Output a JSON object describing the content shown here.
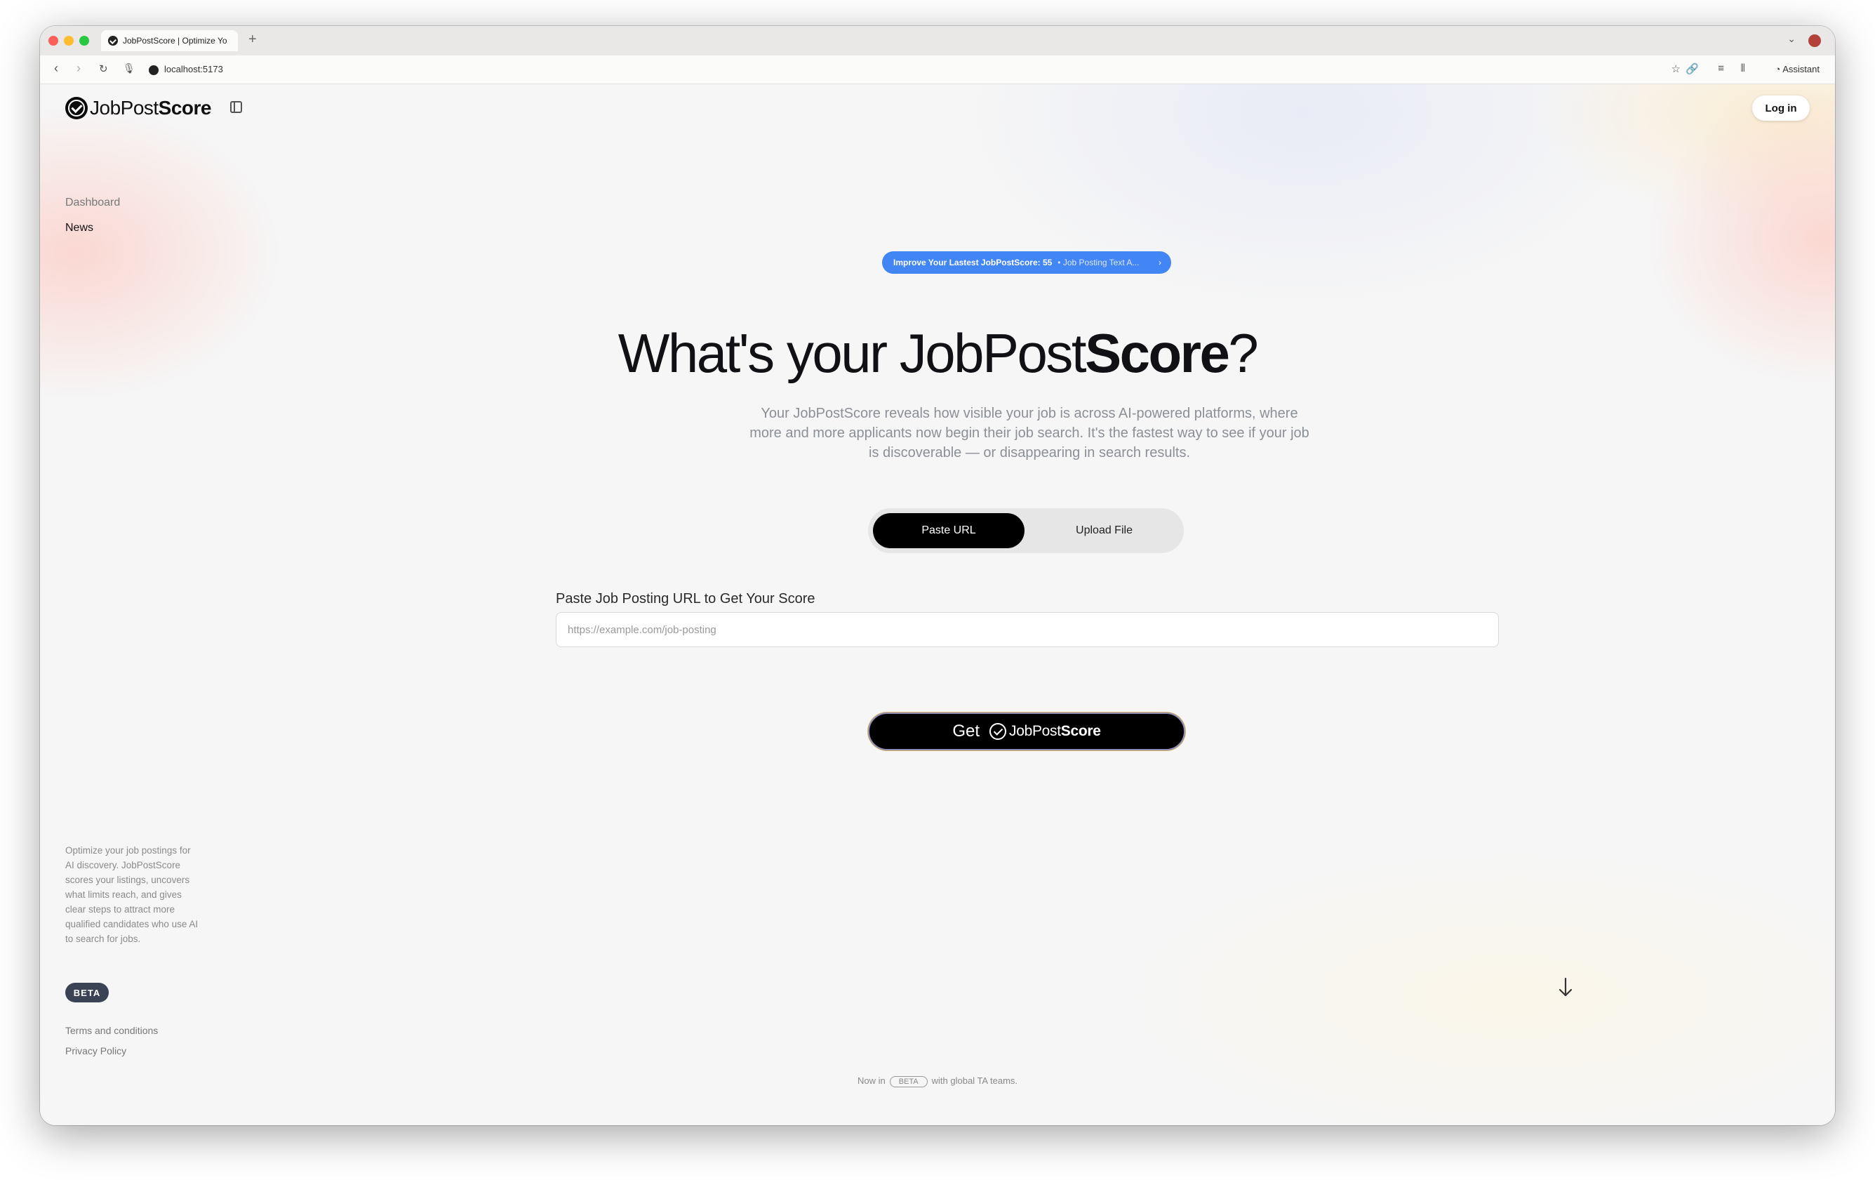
{
  "browser": {
    "tab_title": "JobPostScore | Optimize Yo",
    "new_tab": "+",
    "url": "localhost:5173",
    "assistant_label": "Assistant",
    "traffic_light_colors": [
      "#fe5f57",
      "#febc2e",
      "#28c840"
    ]
  },
  "header": {
    "logo_regular": "JobPost",
    "logo_bold": "Score",
    "login_label": "Log in"
  },
  "sidebar": {
    "items": [
      {
        "label": "Dashboard"
      },
      {
        "label": "News"
      }
    ],
    "description": "Optimize your job postings for AI discovery. JobPostScore scores your listings, uncovers what limits reach, and gives clear steps to attract more qualified candidates who use AI to search for jobs.",
    "badge": "BETA",
    "terms": "Terms and conditions",
    "privacy": "Privacy Policy"
  },
  "banner": {
    "text": "Improve Your Lastest JobPostScore: 55",
    "subtext": "• Job Posting Text A...",
    "arrow": "›",
    "color": "#4285f4"
  },
  "hero": {
    "title_start": "What's your JobPost",
    "title_bold": "Score",
    "title_end": "?",
    "description": "Your JobPostScore reveals how visible your job is across AI-powered platforms, where more and more applicants now begin their job search. It's the fastest way to see if your job is discoverable — or disappearing in search results."
  },
  "mode_toggle": {
    "options": [
      "Paste URL",
      "Upload File"
    ],
    "selected": "Paste URL"
  },
  "url_field": {
    "label": "Paste Job Posting URL to Get Your Score",
    "placeholder": "https://example.com/job-posting",
    "value": ""
  },
  "cta": {
    "get": "Get",
    "brand_regular": "JobPost",
    "brand_bold": "Score"
  },
  "footer": {
    "pre": "Now in",
    "badge": "BETA",
    "post": "with global TA teams."
  }
}
